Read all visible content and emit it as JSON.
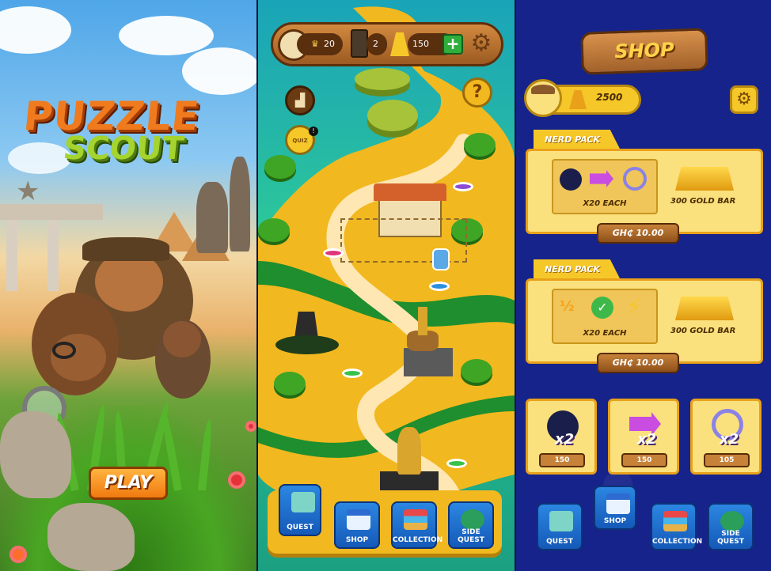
{
  "title_screen": {
    "logo_line1": "PUZZLE",
    "logo_line2": "SCOUT",
    "play_label": "PLAY"
  },
  "map_screen": {
    "topbar": {
      "trophies": "20",
      "cards": "2",
      "gold": "150",
      "add_label": "+"
    },
    "help_label": "?",
    "quiz_label": "QUIZ",
    "nav": [
      {
        "label": "QUEST",
        "active": true
      },
      {
        "label": "SHOP",
        "active": false
      },
      {
        "label": "COLLECTION",
        "active": false
      },
      {
        "label": "SIDE QUEST",
        "active": false
      }
    ]
  },
  "shop_screen": {
    "title": "SHOP",
    "gold_balance": "2500",
    "packs": [
      {
        "tag": "NERD PACK",
        "contents": "X20  EACH",
        "gold": "300 GOLD BAR",
        "price": "GH₵ 10.00",
        "items": [
          "bomb-icon",
          "arrows-icon",
          "target-icon"
        ]
      },
      {
        "tag": "NERD PACK",
        "contents": "X20  EACH",
        "gold": "300 GOLD BAR",
        "price": "GH₵ 10.00",
        "items": [
          "half-icon",
          "check-icon",
          "lightning-icon"
        ]
      }
    ],
    "tiles": [
      {
        "item": "bomb-icon",
        "multiplier": "x2",
        "cost": "150"
      },
      {
        "item": "arrows-icon",
        "multiplier": "x2",
        "cost": "150"
      },
      {
        "item": "target-icon",
        "multiplier": "x2",
        "cost": "105"
      }
    ],
    "nav": [
      {
        "label": "QUEST",
        "active": false
      },
      {
        "label": "SHOP",
        "active": true
      },
      {
        "label": "COLLECTION",
        "active": false
      },
      {
        "label": "SIDE QUEST",
        "active": false
      }
    ]
  },
  "colors": {
    "accent_orange": "#f07a10",
    "gold": "#f6c729",
    "nav_blue": "#1f6fd1",
    "shop_bg": "#16238a"
  }
}
